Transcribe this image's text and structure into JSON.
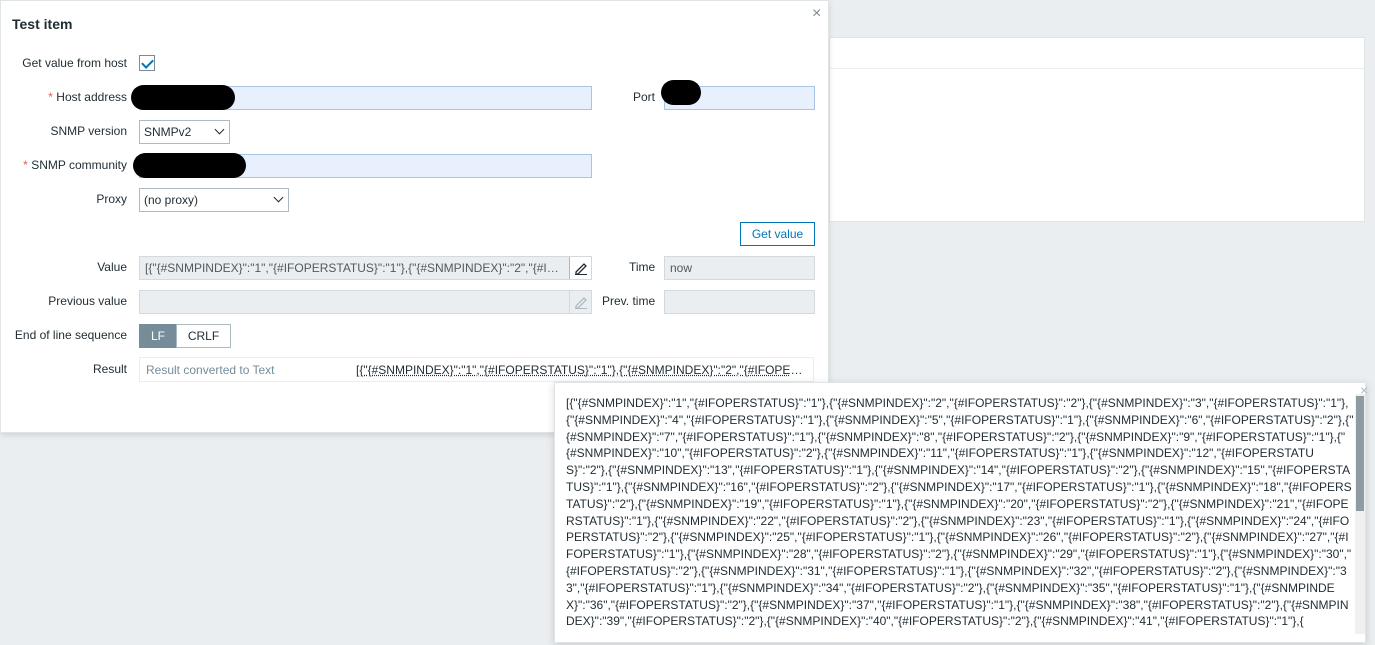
{
  "dialog": {
    "title": "Test item",
    "close_symbol": "×"
  },
  "form": {
    "get_value_label": "Get value from host",
    "get_value_checked": true,
    "host_address_label": "Host address",
    "required_mark": "*",
    "port_label": "Port",
    "snmp_version_label": "SNMP version",
    "snmp_version_value": "SNMPv2",
    "snmp_community_label": "SNMP community",
    "proxy_label": "Proxy",
    "proxy_value": "(no proxy)",
    "get_value_button": "Get value",
    "value_label": "Value",
    "value_text": "[{\"{#SNMPINDEX}\":\"1\",\"{#IFOPERSTATUS}\":\"1\"},{\"{#SNMPINDEX}\":\"2\",\"{#IFOPERSTATUS}\":\"2\"},{\"{#SNMPINDEX}\":\"3\"",
    "time_label": "Time",
    "time_value": "now",
    "previous_value_label": "Previous value",
    "prev_time_label": "Prev. time",
    "eol_label": "End of line sequence",
    "eol_options": [
      "LF",
      "CRLF"
    ],
    "eol_selected": "LF",
    "result_label": "Result",
    "result_hint": "Result converted to Text",
    "result_value": "[{\"{#SNMPINDEX}\":\"1\",\"{#IFOPERSTATUS}\":\"1\"},{\"{#SNMPINDEX}\":\"2\",\"{#IFOPERSTATUS}\":\"2\"}"
  },
  "popup": {
    "close_symbol": "×",
    "text": "[{\"{#SNMPINDEX}\":\"1\",\"{#IFOPERSTATUS}\":\"1\"},{\"{#SNMPINDEX}\":\"2\",\"{#IFOPERSTATUS}\":\"2\"},{\"{#SNMPINDEX}\":\"3\",\"{#IFOPERSTATUS}\":\"1\"},{\"{#SNMPINDEX}\":\"4\",\"{#IFOPERSTATUS}\":\"1\"},{\"{#SNMPINDEX}\":\"5\",\"{#IFOPERSTATUS}\":\"1\"},{\"{#SNMPINDEX}\":\"6\",\"{#IFOPERSTATUS}\":\"2\"},{\"{#SNMPINDEX}\":\"7\",\"{#IFOPERSTATUS}\":\"1\"},{\"{#SNMPINDEX}\":\"8\",\"{#IFOPERSTATUS}\":\"2\"},{\"{#SNMPINDEX}\":\"9\",\"{#IFOPERSTATUS}\":\"1\"},{\"{#SNMPINDEX}\":\"10\",\"{#IFOPERSTATUS}\":\"2\"},{\"{#SNMPINDEX}\":\"11\",\"{#IFOPERSTATUS}\":\"1\"},{\"{#SNMPINDEX}\":\"12\",\"{#IFOPERSTATUS}\":\"2\"},{\"{#SNMPINDEX}\":\"13\",\"{#IFOPERSTATUS}\":\"1\"},{\"{#SNMPINDEX}\":\"14\",\"{#IFOPERSTATUS}\":\"2\"},{\"{#SNMPINDEX}\":\"15\",\"{#IFOPERSTATUS}\":\"1\"},{\"{#SNMPINDEX}\":\"16\",\"{#IFOPERSTATUS}\":\"2\"},{\"{#SNMPINDEX}\":\"17\",\"{#IFOPERSTATUS}\":\"1\"},{\"{#SNMPINDEX}\":\"18\",\"{#IFOPERSTATUS}\":\"2\"},{\"{#SNMPINDEX}\":\"19\",\"{#IFOPERSTATUS}\":\"1\"},{\"{#SNMPINDEX}\":\"20\",\"{#IFOPERSTATUS}\":\"2\"},{\"{#SNMPINDEX}\":\"21\",\"{#IFOPERSTATUS}\":\"1\"},{\"{#SNMPINDEX}\":\"22\",\"{#IFOPERSTATUS}\":\"2\"},{\"{#SNMPINDEX}\":\"23\",\"{#IFOPERSTATUS}\":\"1\"},{\"{#SNMPINDEX}\":\"24\",\"{#IFOPERSTATUS}\":\"2\"},{\"{#SNMPINDEX}\":\"25\",\"{#IFOPERSTATUS}\":\"1\"},{\"{#SNMPINDEX}\":\"26\",\"{#IFOPERSTATUS}\":\"2\"},{\"{#SNMPINDEX}\":\"27\",\"{#IFOPERSTATUS}\":\"1\"},{\"{#SNMPINDEX}\":\"28\",\"{#IFOPERSTATUS}\":\"2\"},{\"{#SNMPINDEX}\":\"29\",\"{#IFOPERSTATUS}\":\"1\"},{\"{#SNMPINDEX}\":\"30\",\"{#IFOPERSTATUS}\":\"2\"},{\"{#SNMPINDEX}\":\"31\",\"{#IFOPERSTATUS}\":\"1\"},{\"{#SNMPINDEX}\":\"32\",\"{#IFOPERSTATUS}\":\"2\"},{\"{#SNMPINDEX}\":\"33\",\"{#IFOPERSTATUS}\":\"1\"},{\"{#SNMPINDEX}\":\"34\",\"{#IFOPERSTATUS}\":\"2\"},{\"{#SNMPINDEX}\":\"35\",\"{#IFOPERSTATUS}\":\"1\"},{\"{#SNMPINDEX}\":\"36\",\"{#IFOPERSTATUS}\":\"2\"},{\"{#SNMPINDEX}\":\"37\",\"{#IFOPERSTATUS}\":\"1\"},{\"{#SNMPINDEX}\":\"38\",\"{#IFOPERSTATUS}\":\"2\"},{\"{#SNMPINDEX}\":\"39\",\"{#IFOPERSTATUS}\":\"2\"},{\"{#SNMPINDEX}\":\"40\",\"{#IFOPERSTATUS}\":\"2\"},{\"{#SNMPINDEX}\":\"41\",\"{#IFOPERSTATUS}\":\"1\"},{"
  },
  "colors": {
    "accent": "#0275b8",
    "required": "#e45959",
    "focus_field": "#e8f0fe"
  }
}
